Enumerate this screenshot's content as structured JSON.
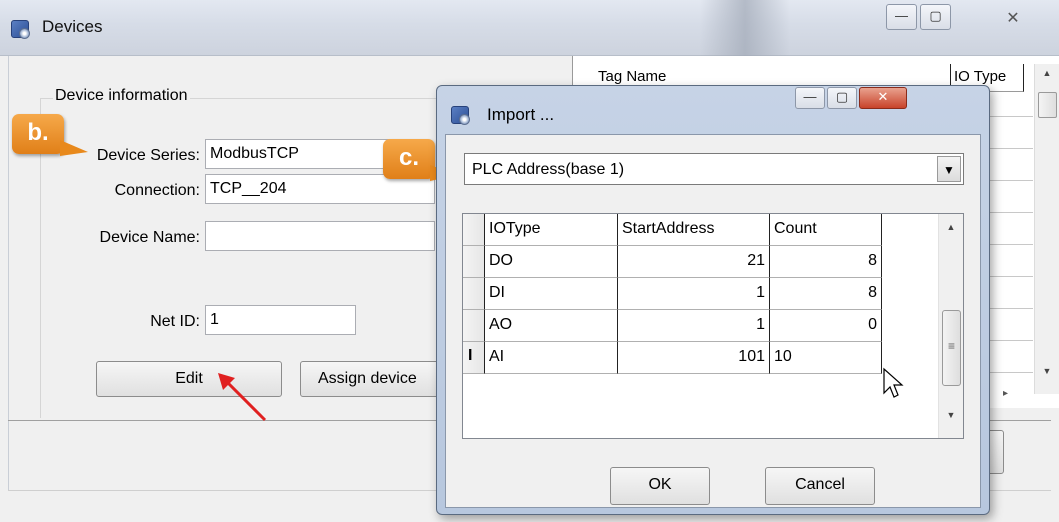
{
  "devices_window": {
    "title": "Devices",
    "minimize_glyph": "—",
    "maximize_glyph": "▢",
    "close_glyph": "✕"
  },
  "device_info": {
    "legend": "Device information",
    "series_label": "Device Series:",
    "series_value": "ModbusTCP",
    "connection_label": "Connection:",
    "connection_value": "TCP__204",
    "name_label": "Device Name:",
    "name_value": "",
    "netid_label": "Net ID:",
    "netid_value": "1",
    "edit_button": "Edit",
    "assign_button": "Assign device"
  },
  "tag_grid": {
    "columns": [
      "Tag Name",
      "IO Type"
    ],
    "up_glyph": "▲",
    "down_glyph": "▼",
    "right_glyph": "▸"
  },
  "badges": {
    "b": "b.",
    "c": "c."
  },
  "import_dialog": {
    "title": "Import ...",
    "combo_value": "PLC Address(base 1)",
    "combo_glyph": "▼",
    "columns": [
      "IOType",
      "StartAddress",
      "Count"
    ],
    "rows": [
      {
        "iotype": "DO",
        "start": "21",
        "count": "8"
      },
      {
        "iotype": "DI",
        "start": "1",
        "count": "8"
      },
      {
        "iotype": "AO",
        "start": "1",
        "count": "0"
      },
      {
        "iotype": "AI",
        "start": "101",
        "count": "10"
      }
    ],
    "edit_cursor": "I",
    "ok_button": "OK",
    "cancel_button": "Cancel",
    "up_glyph": "▲",
    "down_glyph": "▼",
    "thumb_glyph": "≡"
  },
  "colors": {
    "badge": "#e8891c",
    "arrow": "#e02020"
  }
}
